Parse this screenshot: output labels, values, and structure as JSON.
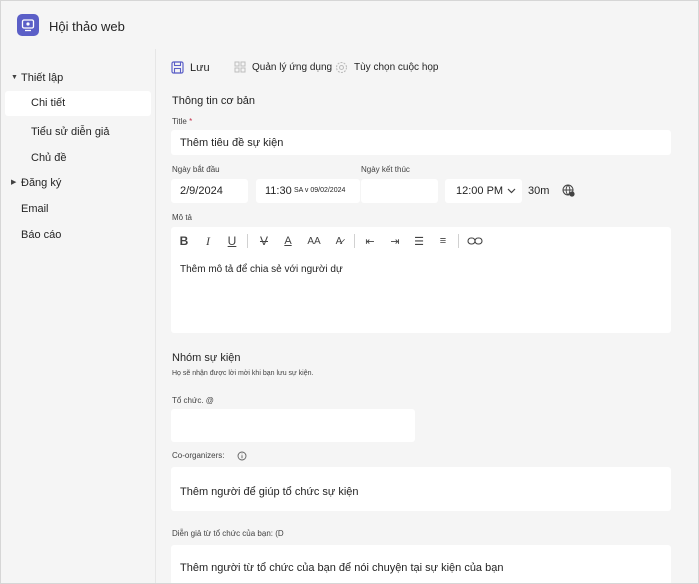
{
  "app": {
    "title": "Hội thảo web"
  },
  "sidebar": {
    "setup_group": "Thiết lập",
    "items": [
      "Chi tiết",
      "Tiểu sử diễn giả",
      "Chủ đề"
    ],
    "registration_group": "Đăng ký",
    "email": "Email",
    "reports": "Báo cáo"
  },
  "toolbar": {
    "save": "Lưu",
    "manage_apps": "Quản lý ứng dụng",
    "meeting_options": "Tùy chọn cuộc họp"
  },
  "basic_info": {
    "heading": "Thông tin cơ bản",
    "title_label": "Title",
    "title_required": "*",
    "title_placeholder": "Thêm tiêu đề sự kiện",
    "start_label": "Ngày bắt đầu",
    "start_date": "2/9/2024",
    "start_time": "11:30",
    "start_time_suffix": "SA v 09/02/2024",
    "end_label": "Ngày kết thúc",
    "end_time": "12:00 PM",
    "duration": "30m",
    "description_label": "Mô tả",
    "description_placeholder": "Thêm mô tả để chia sẻ với người dự"
  },
  "event_group": {
    "heading": "Nhóm sự kiện",
    "note": "Họ sẽ nhận được lời mời khi bạn lưu sự kiện.",
    "organizer_label": "Tổ chức. @",
    "coorganizers_label": "Co-organizers:",
    "coorganizers_placeholder": "Thêm người để giúp tổ chức sự kiện",
    "presenters_label": "Diễn giả từ tổ chức của bạn: (D",
    "presenters_placeholder": "Thêm người từ tổ chức của bạn để nói chuyện tại sự kiện của bạn"
  },
  "colors": {
    "accent": "#5b5fc7",
    "required": "#c4314b"
  }
}
